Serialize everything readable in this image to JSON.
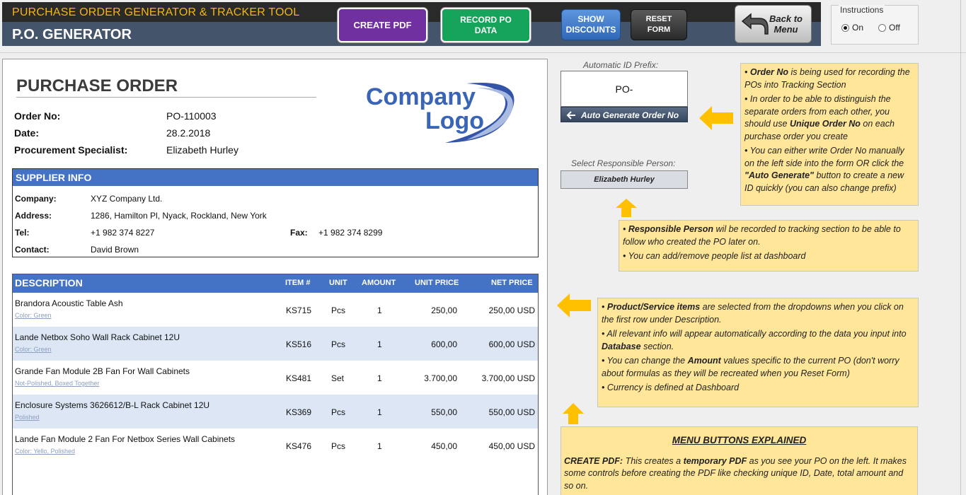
{
  "header": {
    "subtitle": "PURCHASE ORDER GENERATOR & TRACKER TOOL",
    "title": "P.O. GENERATOR",
    "buttons": {
      "create_pdf": "CREATE PDF",
      "record_po": "RECORD PO\nDATA",
      "show_discounts": "SHOW\nDISCOUNTS",
      "reset_form": "RESET\nFORM",
      "back_to_menu": "Back to\nMenu"
    },
    "instructions": {
      "title": "Instructions",
      "on": "On",
      "off": "Off",
      "selected": "On"
    }
  },
  "po": {
    "title": "PURCHASE ORDER",
    "logo": {
      "line1": "Company",
      "line2": "Logo"
    },
    "order_no_label": "Order No:",
    "order_no": "PO-110003",
    "date_label": "Date:",
    "date": "28.2.2018",
    "specialist_label": "Procurement Specialist:",
    "specialist": "Elizabeth Hurley"
  },
  "supplier": {
    "header": "SUPPLIER INFO",
    "company_label": "Company:",
    "company": "XYZ Company Ltd.",
    "address_label": "Address:",
    "address": "1286, Hamilton Pl, Nyack, Rockland, New York",
    "tel_label": "Tel:",
    "tel": "+1 982 374 8227",
    "fax_label": "Fax:",
    "fax": "+1 982 374 8299",
    "contact_label": "Contact:",
    "contact": "David Brown"
  },
  "items": {
    "headers": {
      "description": "DESCRIPTION",
      "item": "ITEM #",
      "unit": "UNIT",
      "amount": "AMOUNT",
      "unit_price": "UNIT PRICE",
      "net_price": "NET PRICE"
    },
    "rows": [
      {
        "name": "Brandora Acoustic Table Ash",
        "note": "Color: Green",
        "item": "KS715",
        "unit": "Pcs",
        "amount": "1",
        "unit_price": "250,00",
        "net_price": "250,00  USD"
      },
      {
        "name": "Lande Netbox Soho Wall Rack Cabinet 12U",
        "note": "Color: Green",
        "item": "KS516",
        "unit": "Pcs",
        "amount": "1",
        "unit_price": "600,00",
        "net_price": "600,00  USD"
      },
      {
        "name": "Grande Fan Module 2B Fan For Wall Cabinets",
        "note": "Not-Polished, Boxed Together",
        "item": "KS481",
        "unit": "Set",
        "amount": "1",
        "unit_price": "3.700,00",
        "net_price": "3.700,00  USD"
      },
      {
        "name": "Enclosure Systems 3626612/B-L Rack Cabinet 12U",
        "note": "Polished",
        "item": "KS369",
        "unit": "Pcs",
        "amount": "1",
        "unit_price": "550,00",
        "net_price": "550,00  USD"
      },
      {
        "name": "Lande Fan Module 2 Fan For Netbox Series Wall Cabinets",
        "note": "Color: Yello, Polished",
        "item": "KS476",
        "unit": "Pcs",
        "amount": "1",
        "unit_price": "450,00",
        "net_price": "450,00  USD"
      }
    ]
  },
  "side": {
    "prefix_label": "Automatic ID Prefix:",
    "prefix_value": "PO-",
    "auto_button": "Auto Generate Order No",
    "resp_label": "Select Responsible Person:",
    "resp_value": "Elizabeth Hurley"
  },
  "notes": {
    "n1": [
      {
        "pre": "• ",
        "b": "Order No",
        "post": " is being used for recording the POs into Tracking Section"
      },
      {
        "pre": "• In order to be able to distinguish the separate orders from each other, you should use ",
        "b": "Unique Order No",
        "post": " on each purchase order you create"
      },
      {
        "pre": "• You can either write Order No manually on the left side into the form OR click the ",
        "b": "\"Auto Generate\"",
        "post": " button to create a new ID quickly (you can also change prefix)"
      }
    ],
    "n2": [
      {
        "pre": "• ",
        "b": "Responsible Person",
        "post": " wil be recorded to tracking section to be able to follow who created the PO later on."
      },
      {
        "pre": "• You can add/remove people list at dashboard",
        "b": "",
        "post": ""
      }
    ],
    "n3": [
      {
        "pre": "• ",
        "b": "Product/Service items",
        "post": " are selected from the dropdowns when you click on the first row under Description."
      },
      {
        "pre": "• All relevant info will appear automatically according to the data you input into ",
        "b": "Database",
        "post": " section."
      },
      {
        "pre": "• You can change the ",
        "b": "Amount",
        "post": " values specific to the current PO (don't worry about formulas as they will be recreated when you Reset Form)"
      },
      {
        "pre": "• Currency is defined at Dashboard",
        "b": "",
        "post": ""
      }
    ],
    "n4_title": "MENU BUTTONS EXPLAINED",
    "n4": [
      {
        "pre": "",
        "b": "CREATE PDF:",
        "post": " This creates a "
      },
      {
        "pre": "",
        "b": "temporary PDF",
        "post": " as you see your PO on the left. It makes some controls before creating the PDF like checking unique ID, Date, total amount and so on."
      }
    ]
  },
  "colors": {
    "header_bg": "#44546a",
    "accent_blue": "#4472c4",
    "note_bg": "#ffe699",
    "arrow": "#ffc000"
  }
}
